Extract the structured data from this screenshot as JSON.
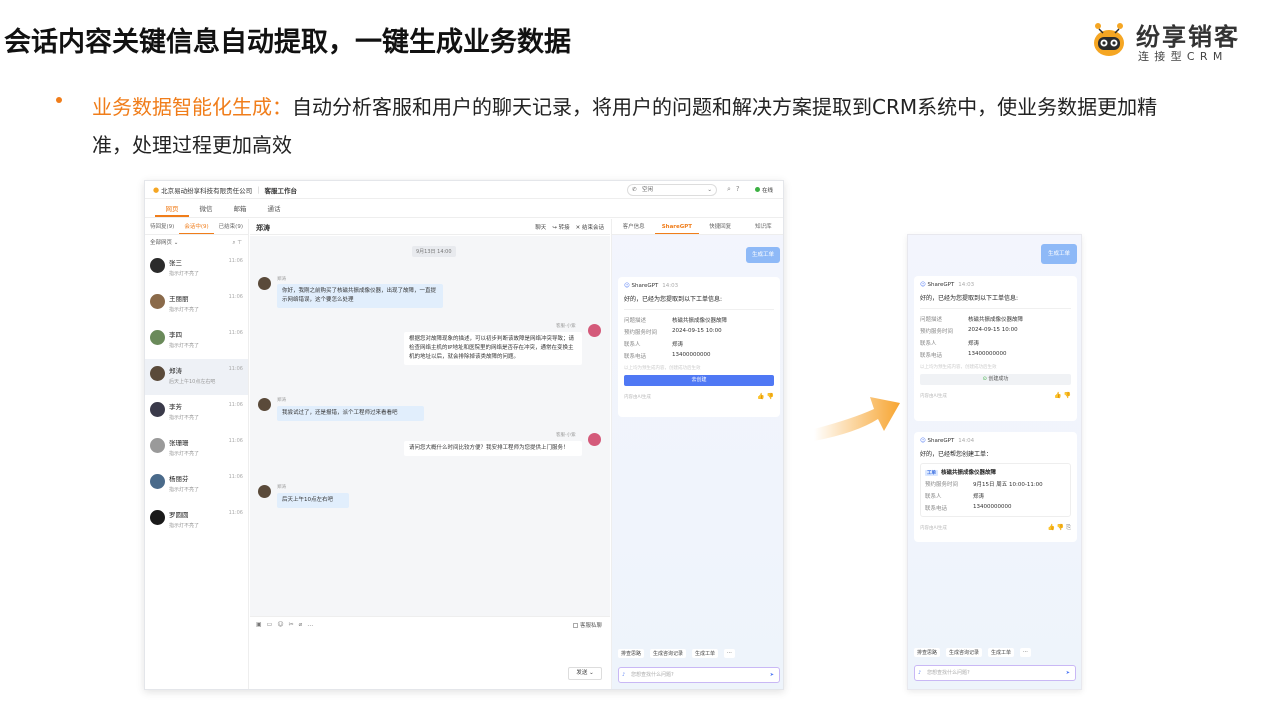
{
  "slide": {
    "title": "会话内容关键信息自动提取，一键生成业务数据",
    "bullet_highlight": "业务数据智能化生成：",
    "bullet_text": "自动分析客服和用户的聊天记录，将用户的问题和解决方案提取到CRM系统中，使业务数据更加精准，处理过程更加高效"
  },
  "logo": {
    "name": "纷享销客",
    "sub": "连接型CRM"
  },
  "app": {
    "company": "北京易动纷享科技有限责任公司",
    "workspace": "客服工作台",
    "call_label": "空闲",
    "status": "在线",
    "nav_tabs": [
      "网页",
      "微信",
      "邮箱",
      "通话"
    ],
    "list_tabs": [
      "待回复(9)",
      "会话中(9)",
      "已结束(9)"
    ],
    "list_filter": "全部网页",
    "contacts": [
      {
        "name": "张三",
        "msg": "指示灯不亮了",
        "time": "11:06",
        "color": "#2b2b2b"
      },
      {
        "name": "王丽丽",
        "msg": "指示灯不亮了",
        "time": "11:06",
        "color": "#8a6a4a"
      },
      {
        "name": "李四",
        "msg": "指示灯不亮了",
        "time": "11:06",
        "color": "#6a8a5a"
      },
      {
        "name": "郑涛",
        "msg": "后天上午10点左右吧",
        "time": "11:06",
        "color": "#5a4a3a"
      },
      {
        "name": "李芳",
        "msg": "指示灯不亮了",
        "time": "11:06",
        "color": "#3a3a4a"
      },
      {
        "name": "张珊珊",
        "msg": "指示灯不亮了",
        "time": "11:06",
        "color": "#9a9a9a"
      },
      {
        "name": "杨丽芬",
        "msg": "指示灯不亮了",
        "time": "11:06",
        "color": "#4a6a8a"
      },
      {
        "name": "罗圆圆",
        "msg": "指示灯不亮了",
        "time": "11:06",
        "color": "#1a1a1a"
      }
    ],
    "chat": {
      "name": "郑涛",
      "actions": [
        "聊天",
        "转接",
        "结束会话"
      ],
      "date": "9月13日 14:00",
      "customer": "郑涛",
      "agent": "客服-小紫",
      "m1": "你好，我刚之前购买了核磁共振成像仪器，出现了故障，一直提示网络错误，这个要怎么处理",
      "m2": "根据您对故障现象的描述，可以初步判断该故障是网络冲突导致；请检查网络主机的IP地址和医院里的网络是否存在冲突，通常在变换主机的地址以后，就会排除掉该类故障的问题。",
      "m3": "我尝试过了，还是报错，派个工程师过来看看吧",
      "m4": "请问您大概什么时间比较方便？我安排工程师为您提供上门服务！",
      "m5": "后天上午10点左右吧",
      "private_label": "客服私聊",
      "send_label": "发送"
    },
    "right_tabs": [
      "客户信息",
      "ShareGPT",
      "快捷回复",
      "知识库"
    ],
    "gen_ticket": "生成工单",
    "gpt": {
      "name": "ShareGPT",
      "time1": "14:03",
      "time2": "14:04",
      "intro": "好的，已经为您提取到以下工单信息:",
      "fields": [
        {
          "k": "问题描述",
          "v": "核磁共振成像仪器故障"
        },
        {
          "k": "预约服务时间",
          "v": "2024-09-15  10:00"
        },
        {
          "k": "联系人",
          "v": "郑涛"
        },
        {
          "k": "联系电话",
          "v": "13400000000"
        }
      ],
      "note": "以上均为预生成内容，创建成功后生效",
      "create_btn": "去创建",
      "created": "创建成功",
      "ai_note": "内容由AI生成",
      "done_intro": "好的，已经帮您创建工单：",
      "ticket_tag": "工单",
      "ticket_title": "核磁共振成像仪器故障",
      "ticket_fields": [
        {
          "k": "预约服务时间",
          "v": "9月15日 周五 10:00-11:00"
        },
        {
          "k": "联系人",
          "v": "郑涛"
        },
        {
          "k": "联系电话",
          "v": "13400000000"
        }
      ],
      "quick": [
        "排查思路",
        "生成咨询记录",
        "生成工单",
        "···"
      ],
      "input_placeholder": "您想查找什么问题?"
    }
  }
}
